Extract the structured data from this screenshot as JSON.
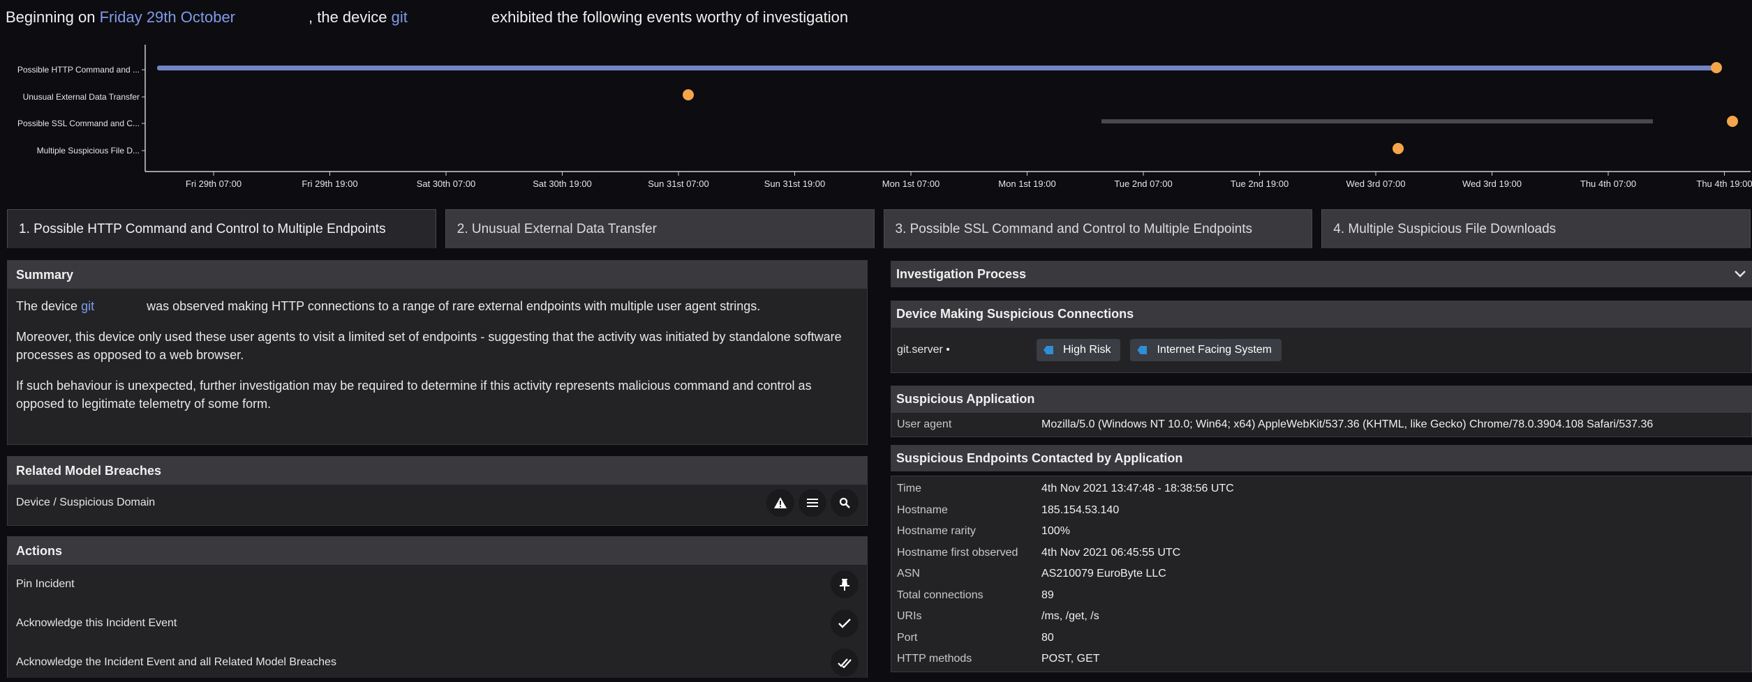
{
  "header": {
    "prefix": "Beginning on",
    "date": "Friday 29th October",
    "middle": ", the device",
    "device": "git",
    "suffix": "exhibited the following events worthy of investigation"
  },
  "timeline": {
    "rows": [
      "Possible HTTP Command and ...",
      "Unusual External Data Transfer",
      "Possible SSL Command and C...",
      "Multiple Suspicious File D..."
    ],
    "ticks": [
      "Fri 29th 07:00",
      "Fri 29th 19:00",
      "Sat 30th 07:00",
      "Sat 30th 19:00",
      "Sun 31st 07:00",
      "Sun 31st 19:00",
      "Mon 1st 07:00",
      "Mon 1st 19:00",
      "Tue 2nd 07:00",
      "Tue 2nd 19:00",
      "Wed 3rd 07:00",
      "Wed 3rd 19:00",
      "Thu 4th 07:00",
      "Thu 4th 19:00"
    ],
    "bar_color": "#7184c4",
    "dot_color": "#f5a54a",
    "gray_bar_color": "#4a4a4e"
  },
  "tabs": [
    "1. Possible HTTP Command and Control to Multiple Endpoints",
    "2. Unusual External Data Transfer",
    "3. Possible SSL Command and Control to Multiple Endpoints",
    "4. Multiple Suspicious File Downloads"
  ],
  "summary": {
    "title": "Summary",
    "p1_prefix": "The device",
    "p1_device": "git",
    "p1_suffix": "was observed making HTTP connections to a range of rare external endpoints with multiple user agent strings.",
    "p2": "Moreover, this device only used these user agents to visit a limited set of endpoints - suggesting that the activity was initiated by standalone software processes as opposed to a web browser.",
    "p3": "If such behaviour is unexpected, further investigation may be required to determine if this activity represents malicious command and control as opposed to legitimate telemetry of some form."
  },
  "related": {
    "title": "Related Model Breaches",
    "item": "Device / Suspicious Domain"
  },
  "actions": {
    "title": "Actions",
    "items": [
      "Pin Incident",
      "Acknowledge this Incident Event",
      "Acknowledge the Incident Event and all Related Model Breaches"
    ]
  },
  "investigation": {
    "title": "Investigation Process",
    "device_section": "Device Making Suspicious Connections",
    "device_name": "git.server",
    "device_dot": "•",
    "tags": [
      "High Risk",
      "Internet Facing System"
    ],
    "app_section": "Suspicious Application",
    "user_agent_label": "User agent",
    "user_agent": "Mozilla/5.0 (Windows NT 10.0; Win64; x64) AppleWebKit/537.36 (KHTML, like Gecko) Chrome/78.0.3904.108 Safari/537.36",
    "endpoints_section": "Suspicious Endpoints Contacted by Application",
    "endpoints": [
      {
        "k": "Time",
        "v": "4th Nov 2021 13:47:48 - 18:38:56 UTC"
      },
      {
        "k": "Hostname",
        "v": "185.154.53.140"
      },
      {
        "k": "Hostname rarity",
        "v": "100%"
      },
      {
        "k": "Hostname first observed",
        "v": "4th Nov 2021 06:45:55 UTC"
      },
      {
        "k": "ASN",
        "v": "AS210079 EuroByte LLC"
      },
      {
        "k": "Total connections",
        "v": "89"
      },
      {
        "k": "URIs",
        "v": "/ms, /get, /s"
      },
      {
        "k": "Port",
        "v": "80"
      },
      {
        "k": "HTTP methods",
        "v": "POST, GET"
      }
    ]
  }
}
